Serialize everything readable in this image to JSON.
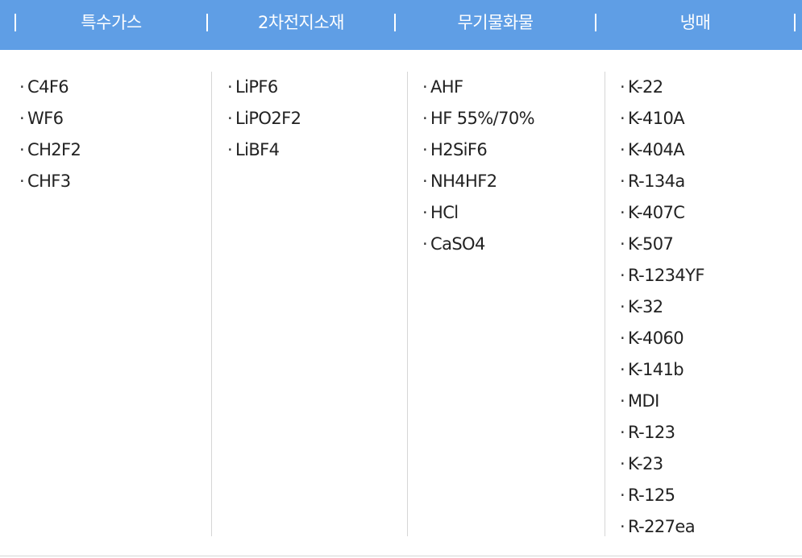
{
  "header": {
    "background": "#5f9ee5",
    "tabs": [
      {
        "label": "특수가스"
      },
      {
        "label": "2차전지소재"
      },
      {
        "label": "무기물화물"
      },
      {
        "label": "냉매"
      }
    ]
  },
  "bullet": "·",
  "columns": [
    {
      "items": [
        "C4F6",
        "WF6",
        "CH2F2",
        "CHF3"
      ]
    },
    {
      "items": [
        "LiPF6",
        "LiPO2F2",
        "LiBF4"
      ]
    },
    {
      "items": [
        "AHF",
        "HF 55%/70%",
        "H2SiF6",
        "NH4HF2",
        "HCl",
        "CaSO4"
      ]
    },
    {
      "items": [
        "K-22",
        "K-410A",
        "K-404A",
        "R-134a",
        "K-407C",
        "K-507",
        "R-1234YF",
        "K-32",
        "K-4060",
        "K-141b",
        "MDI",
        "R-123",
        "K-23",
        "R-125",
        "R-227ea"
      ]
    }
  ]
}
